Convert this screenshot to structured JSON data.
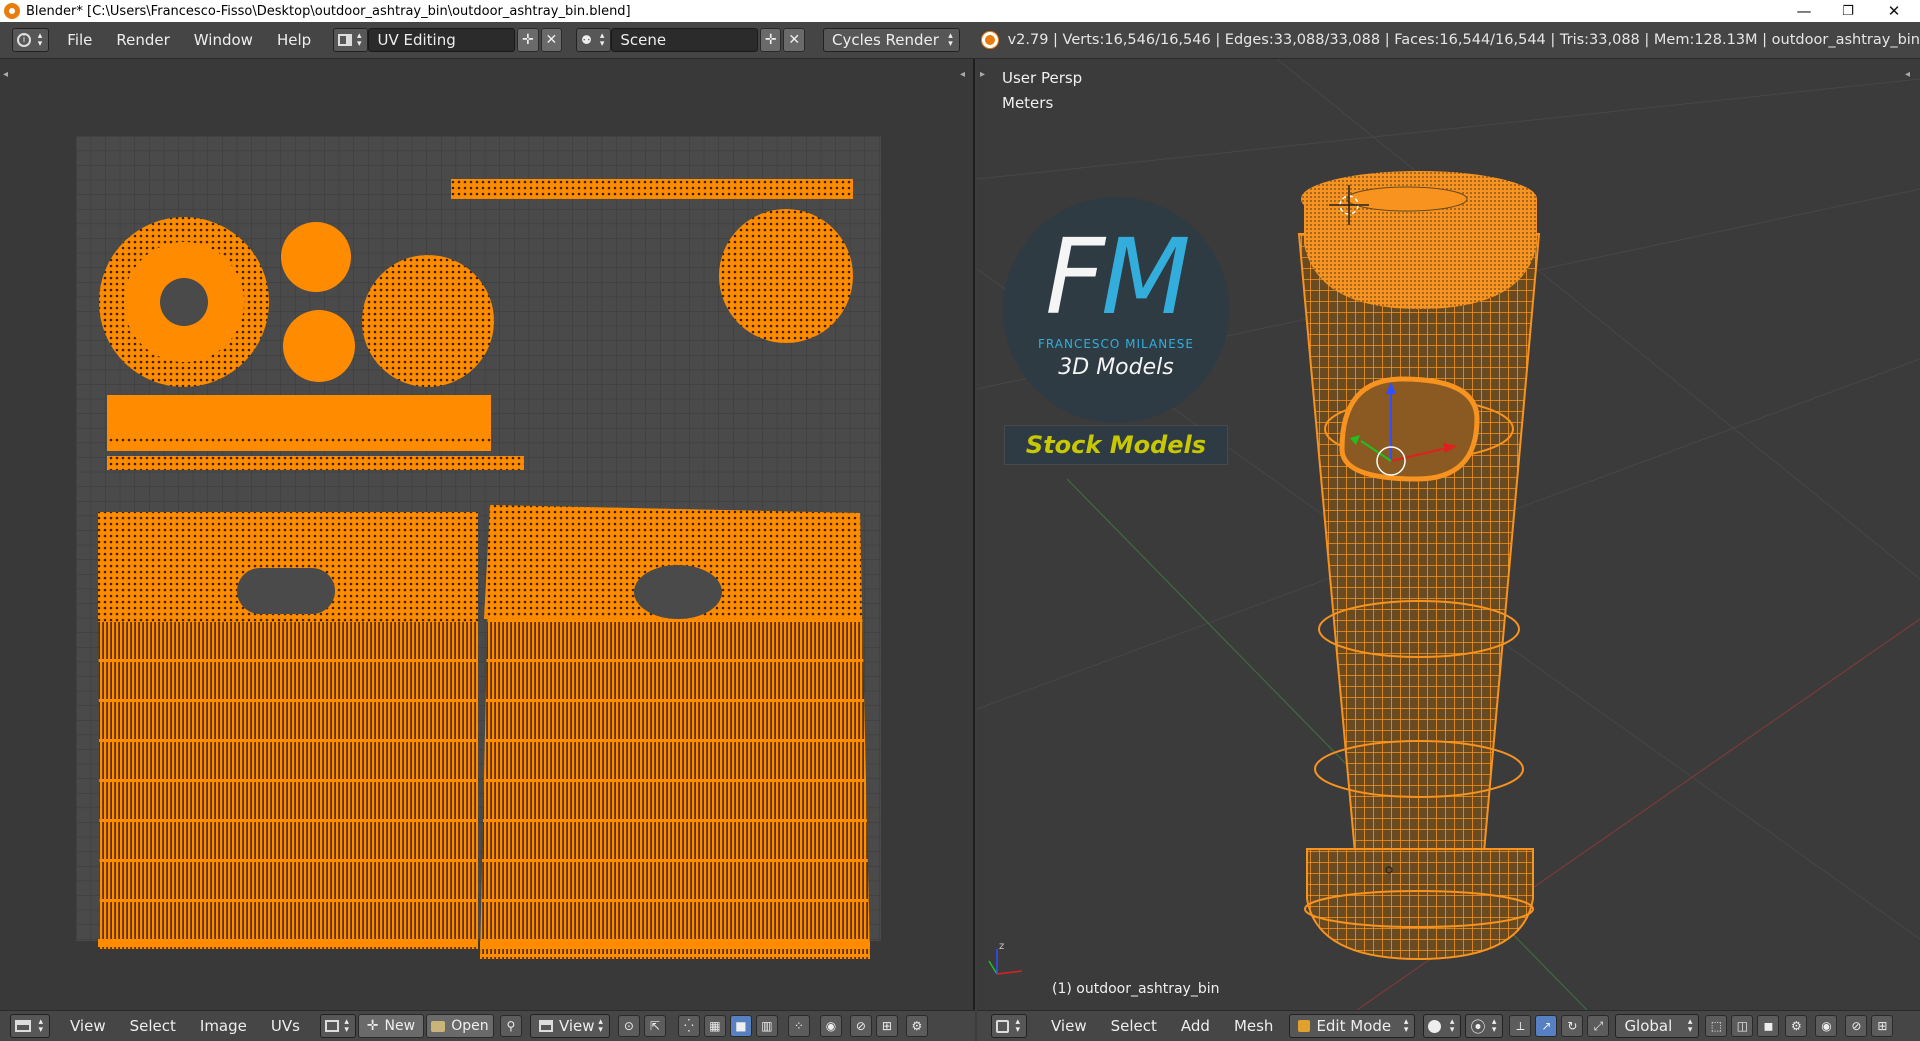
{
  "window": {
    "title": "Blender* [C:\\Users\\Francesco-Fisso\\Desktop\\outdoor_ashtray_bin\\outdoor_ashtray_bin.blend]",
    "minimize": "—",
    "maximize": "❐",
    "close": "✕"
  },
  "topbar": {
    "menus": [
      "File",
      "Render",
      "Window",
      "Help"
    ],
    "screen_layout": "UV Editing",
    "scene": "Scene",
    "render_engine": "Cycles Render",
    "stats": "v2.79 | Verts:16,546/16,546 | Edges:33,088/33,088 | Faces:16,544/16,544 | Tris:33,088 | Mem:128.13M | outdoor_ashtray_bin"
  },
  "uv_editor": {
    "menus": [
      "View",
      "Select",
      "Image",
      "UVs"
    ],
    "new_label": "New",
    "open_label": "Open",
    "view_label": "View"
  },
  "viewport": {
    "view_name": "User Persp",
    "units": "Meters",
    "object_label": "(1) outdoor_ashtray_bin",
    "menus": [
      "View",
      "Select",
      "Add",
      "Mesh"
    ],
    "mode": "Edit Mode",
    "orientation": "Global",
    "logo": {
      "letters": "FM",
      "name": "FRANCESCO MILANESE",
      "subtitle": "3D Models",
      "banner": "Stock Models"
    }
  },
  "colors": {
    "uv_orange": "#ff8c00",
    "wire_orange": "#f7931e",
    "logo_blue": "#33b5e5",
    "banner_yellow": "#c8c800"
  }
}
